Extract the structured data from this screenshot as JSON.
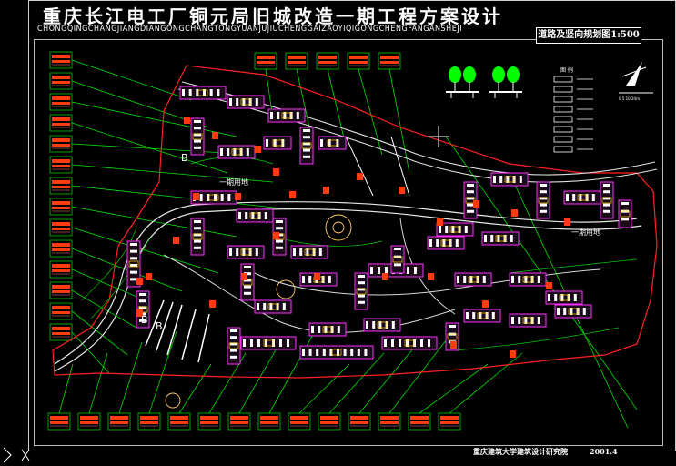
{
  "title": "重庆长江电工厂铜元局旧城改造一期工程方案设计",
  "subtitle": "CHONGQINGCHANGJIANGDIANGONGCHANGTONGYUANJUJIUCHENGGAIZAOYIQIGONGCHENGFANGANSHEJI",
  "map_label": "道路及竖向规划图1:500",
  "footer": {
    "org": "重庆建筑大学建筑设计研究院",
    "date": "2001.4"
  },
  "site_labels": {
    "phase1_left": "一期用地",
    "phase1_right": "一期用地",
    "zone_b1": "B",
    "zone_b2": "B",
    "zone_b3": "B"
  },
  "legend": {
    "heading": "图    例"
  },
  "colors": {
    "background": "#000000",
    "green_lines": "#00ff00",
    "red_lines": "#ff2020",
    "building_outline": "#ff00ff",
    "red_blocks": "#ff3b10",
    "yellow": "#ffff66"
  }
}
